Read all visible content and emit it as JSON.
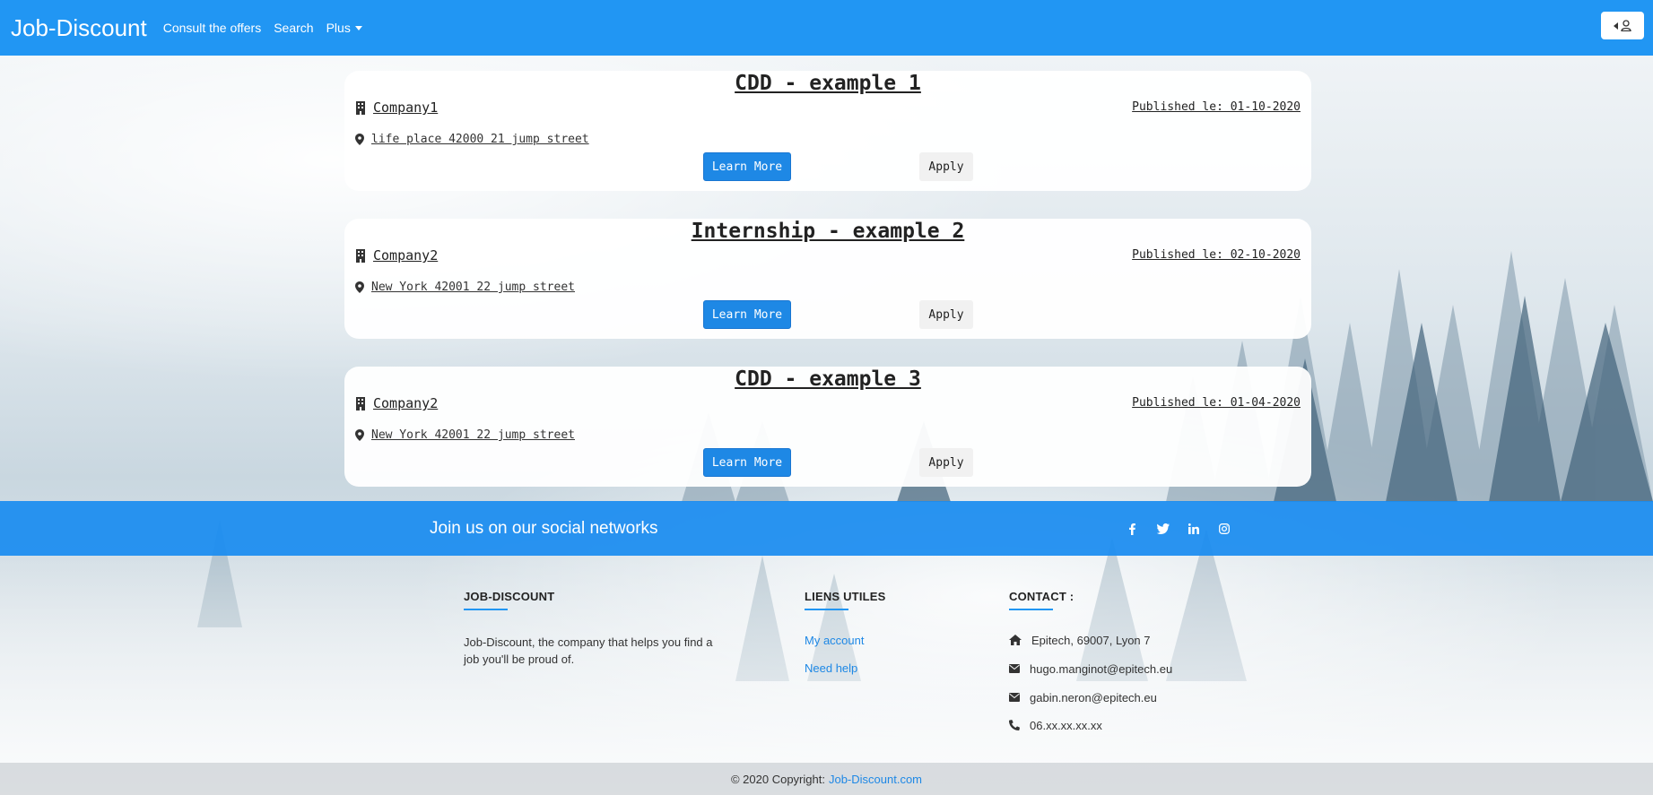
{
  "navbar": {
    "brand": "Job-Discount",
    "links": [
      "Consult the offers",
      "Search",
      "Plus"
    ],
    "user_button_icon": "user-icon"
  },
  "offers": [
    {
      "title": "CDD - example 1",
      "company": "Company1",
      "published": "Published le: 01-10-2020",
      "address": "life place 42000 21 jump street",
      "learn_label": "Learn More",
      "apply_label": "Apply"
    },
    {
      "title": "Internship - example 2",
      "company": "Company2",
      "published": "Published le: 02-10-2020",
      "address": "New York 42001 22 jump street",
      "learn_label": "Learn More",
      "apply_label": "Apply"
    },
    {
      "title": "CDD - example 3",
      "company": "Company2",
      "published": "Published le: 01-04-2020",
      "address": "New York 42001 22 jump street",
      "learn_label": "Learn More",
      "apply_label": "Apply"
    }
  ],
  "social": {
    "text": "Join us on our social networks",
    "icons": [
      "facebook-icon",
      "twitter-icon",
      "linkedin-icon",
      "instagram-icon"
    ]
  },
  "footer": {
    "about_title": "JOB-DISCOUNT",
    "about_text": "Job-Discount, the company that helps you find a job you'll be proud of.",
    "links_title": "LIENS UTILES",
    "links": [
      "My account",
      "Need help"
    ],
    "contact_title": "CONTACT :",
    "contact": {
      "address": "Epitech, 69007, Lyon 7",
      "email1": "hugo.manginot@epitech.eu",
      "email2": "gabin.neron@epitech.eu",
      "phone": "06.xx.xx.xx.xx"
    }
  },
  "copyright": {
    "text": "© 2020 Copyright:",
    "link": "Job-Discount.com"
  },
  "colors": {
    "primary": "#2196f3",
    "button": "#1e88e5",
    "link": "#1e88e5"
  }
}
